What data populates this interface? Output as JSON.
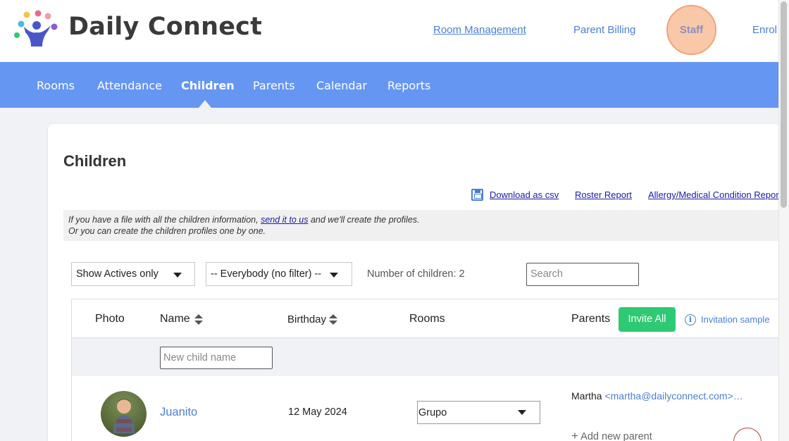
{
  "brand": {
    "name": "Daily Connect"
  },
  "topnav": {
    "room_management": "Room Management",
    "parent_billing": "Parent Billing",
    "staff": "Staff",
    "enrollment": "Enrol"
  },
  "nav": {
    "items": [
      {
        "label": "Rooms"
      },
      {
        "label": "Attendance"
      },
      {
        "label": "Children",
        "active": true
      },
      {
        "label": "Parents"
      },
      {
        "label": "Calendar"
      },
      {
        "label": "Reports"
      }
    ]
  },
  "page": {
    "title": "Children",
    "links": {
      "download_csv": "Download as csv",
      "roster_report": "Roster Report",
      "allergy_report": "Allergy/Medical Condition Report"
    },
    "info": {
      "line1_before": "If you have a file with all the children information, ",
      "line1_link": "send it to us",
      "line1_after": " and we'll create the profiles.",
      "line2": "Or you can create the children profiles one by one."
    }
  },
  "filters": {
    "status": "Show Actives only",
    "group": "-- Everybody (no filter) --",
    "count_label": "Number of children: 2",
    "search_placeholder": "Search"
  },
  "table": {
    "headers": {
      "photo": "Photo",
      "name": "Name",
      "birthday": "Birthday",
      "rooms": "Rooms",
      "parents": "Parents"
    },
    "invite_all": "Invite All",
    "invitation_sample": "Invitation sample",
    "new_child_placeholder": "New child name",
    "rows": [
      {
        "name": "Juanito",
        "birthday": "12 May 2024",
        "room": "Grupo",
        "parent_name": "Martha",
        "parent_email": "<martha@dailyconnect.com>…",
        "add_parent": "Add new parent"
      }
    ]
  },
  "colors": {
    "nav_bg": "#6596f2",
    "link_blue": "#4a7fd4",
    "invite_green": "#2ec973",
    "staff_highlight": "#f8c8a8"
  }
}
